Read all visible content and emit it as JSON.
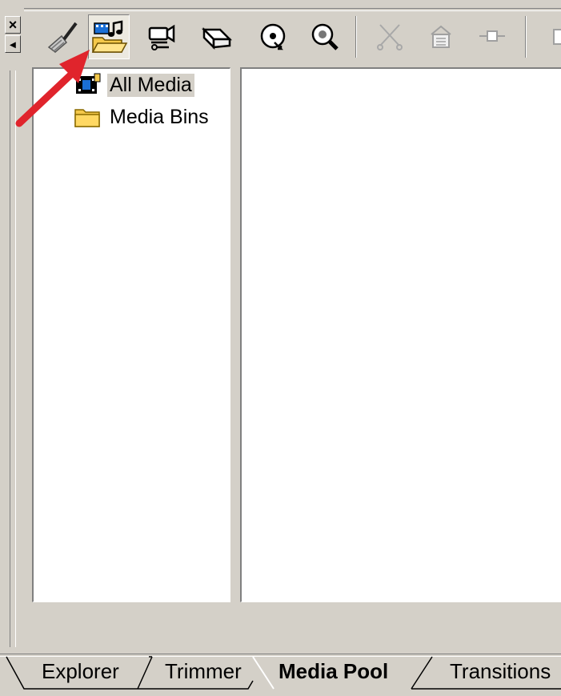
{
  "left_strip": {
    "close_glyph": "×",
    "collapse_glyph": "◂"
  },
  "toolbar": {
    "buttons": [
      {
        "name": "clean-up-tool-icon",
        "state": "normal"
      },
      {
        "name": "media-pool-folder-icon",
        "state": "pressed"
      },
      {
        "name": "capture-video-icon",
        "state": "normal"
      },
      {
        "name": "scanner-icon",
        "state": "normal"
      },
      {
        "name": "disc-icon",
        "state": "normal"
      },
      {
        "name": "search-icon",
        "state": "normal"
      },
      {
        "name": "cut-icon",
        "state": "disabled"
      },
      {
        "name": "properties-icon",
        "state": "disabled"
      },
      {
        "name": "connector-icon",
        "state": "disabled"
      }
    ]
  },
  "tree": {
    "items": [
      {
        "label": "All Media",
        "icon": "film-strip-icon",
        "selected": true
      },
      {
        "label": "Media Bins",
        "icon": "folder-icon",
        "selected": false
      }
    ]
  },
  "tabs": [
    {
      "label": "Explorer",
      "active": false
    },
    {
      "label": "Trimmer",
      "active": false
    },
    {
      "label": "Media Pool",
      "active": true
    },
    {
      "label": "Transitions",
      "active": false
    }
  ],
  "colors": {
    "face": "#d4d0c8",
    "annotation_arrow": "#e0242c",
    "pressed_bg": "#ece9e0"
  }
}
